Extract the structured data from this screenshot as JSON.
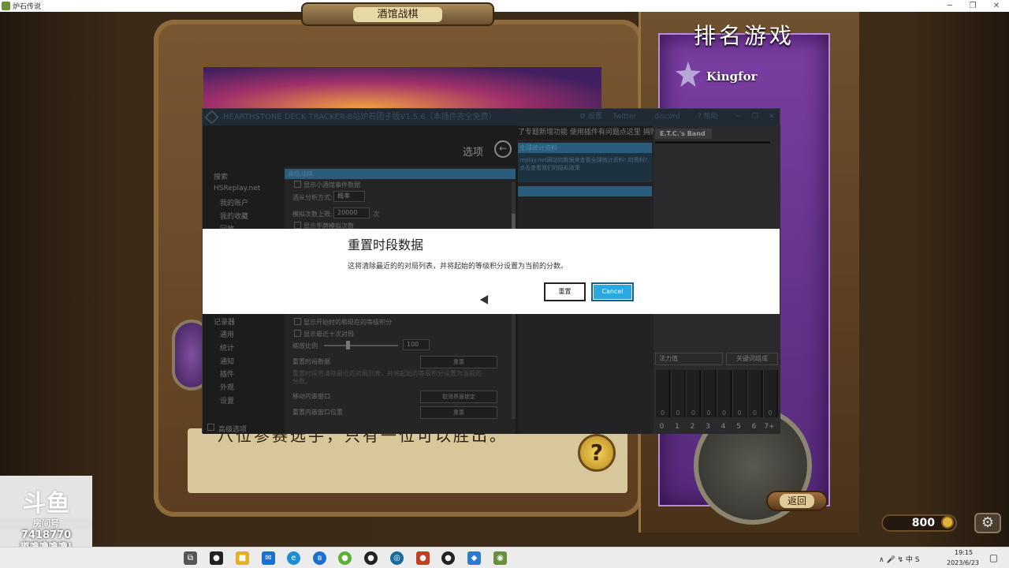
{
  "window": {
    "title": "炉石传说",
    "min": "─",
    "restore": "❐",
    "close": "✕"
  },
  "game": {
    "plaque": "酒馆战棋",
    "rank_title": "排名游戏",
    "player_name": "Kingfor",
    "parchment_text": "八位参赛选手，只有一位可以胜出。",
    "help": "?",
    "back": "返回",
    "gold": "800",
    "gear": "⚙"
  },
  "tracker": {
    "title": "HEARTHSTONE DECK TRACKER-B站炉石团子版V1.5.6（本插件完全免费）",
    "title_buttons": [
      "⚙ 設置",
      "Twitter",
      "discord",
      "? 帮助"
    ],
    "options_header": "选项",
    "nav": [
      "搜索",
      "HSReplay.net",
      "我的账户",
      "我的收藏",
      "回放",
      "记录器",
      "通用",
      "统计",
      "通知",
      "插件",
      "外观",
      "设置",
      "高级选项"
    ],
    "section_title": "高级战棋",
    "settings": {
      "show_small_cards": "显示小酒馆事件数据",
      "analysis_mode_label": "酒从分析方式:",
      "analysis_mode_value": "概率",
      "sim_limit_label": "模拟次数上限:",
      "sim_limit_value": "20000",
      "sim_limit_unit": "次",
      "show_hidden": "显示手牌模拟次数",
      "show_start_rank": "显示开始时的和现在的等级积分",
      "show_recent": "显示最近十次对局",
      "zoom_label": "缩放比例",
      "zoom_value": "100",
      "reset_session_label": "重置时段数据",
      "reset_session_btn": "重置",
      "reset_session_desc": "重置时段将清除最近的对局列表，并将起始的等级积分设置为当前的分数。",
      "move_overlay_label": "移动内嵌窗口",
      "move_overlay_btn": "取消界面锁定",
      "reset_overlay_label": "重置内嵌窗口位置",
      "reset_overlay_btn": "重置"
    },
    "right_links": "了专题新增功能  使用插件有问题点这里  捐赠打赏",
    "info_head": "全球统计资料",
    "info_text": "replay.net网站的数据来查看全球统计资料! 的资料? 点击查看我们的隐私政策",
    "deck_name": "E.T.C.'s Band",
    "mana_select": "法力值",
    "keyword_btn": "关键词组成",
    "mana_counts": [
      "0",
      "0",
      "0",
      "0",
      "0",
      "0",
      "0",
      "0"
    ],
    "mana_labels": [
      "0",
      "1",
      "2",
      "3",
      "4",
      "5",
      "6",
      "7+"
    ]
  },
  "dialog": {
    "title": "重置时段数据",
    "message": "这将清除最近的的对局列表，并将起始的等级积分设置为当前的分数。",
    "reset_button": "重置",
    "cancel_button": "Cancel"
  },
  "douyu": {
    "logo": "斗鱼",
    "tag": "房间号",
    "room": "7418770",
    "message": "嘟噜噜噜噜!"
  },
  "taskbar": {
    "tray": "∧  🎤  ↯  中  S",
    "time": "19:15",
    "date": "2023/6/23"
  }
}
